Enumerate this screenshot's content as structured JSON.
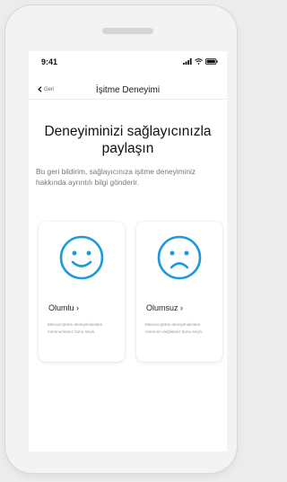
{
  "status": {
    "time": "9:41"
  },
  "nav": {
    "back_label": "Geri",
    "title": "İşitme Deneyimi"
  },
  "main": {
    "heading": "Deneyiminizi sağlayıcınızla paylaşın",
    "description": "Bu geri bildirim, sağlayıcınıza işitme deneyiminiz hakkında ayrıntılı bilgi gönderir."
  },
  "cards": [
    {
      "label": "Olumlu ›",
      "note": "Mevcut işitme deneyiminizden memnunsanız bunu seçin.",
      "icon": "smiley-face-icon"
    },
    {
      "label": "Olumsuz ›",
      "note": "Mevcut işitme deneyiminizden memnun değilseniz bunu seçin.",
      "icon": "sad-face-icon"
    }
  ],
  "colors": {
    "accent": "#1b9bd8",
    "background": "#f3f3f3",
    "card": "#ffffff"
  }
}
